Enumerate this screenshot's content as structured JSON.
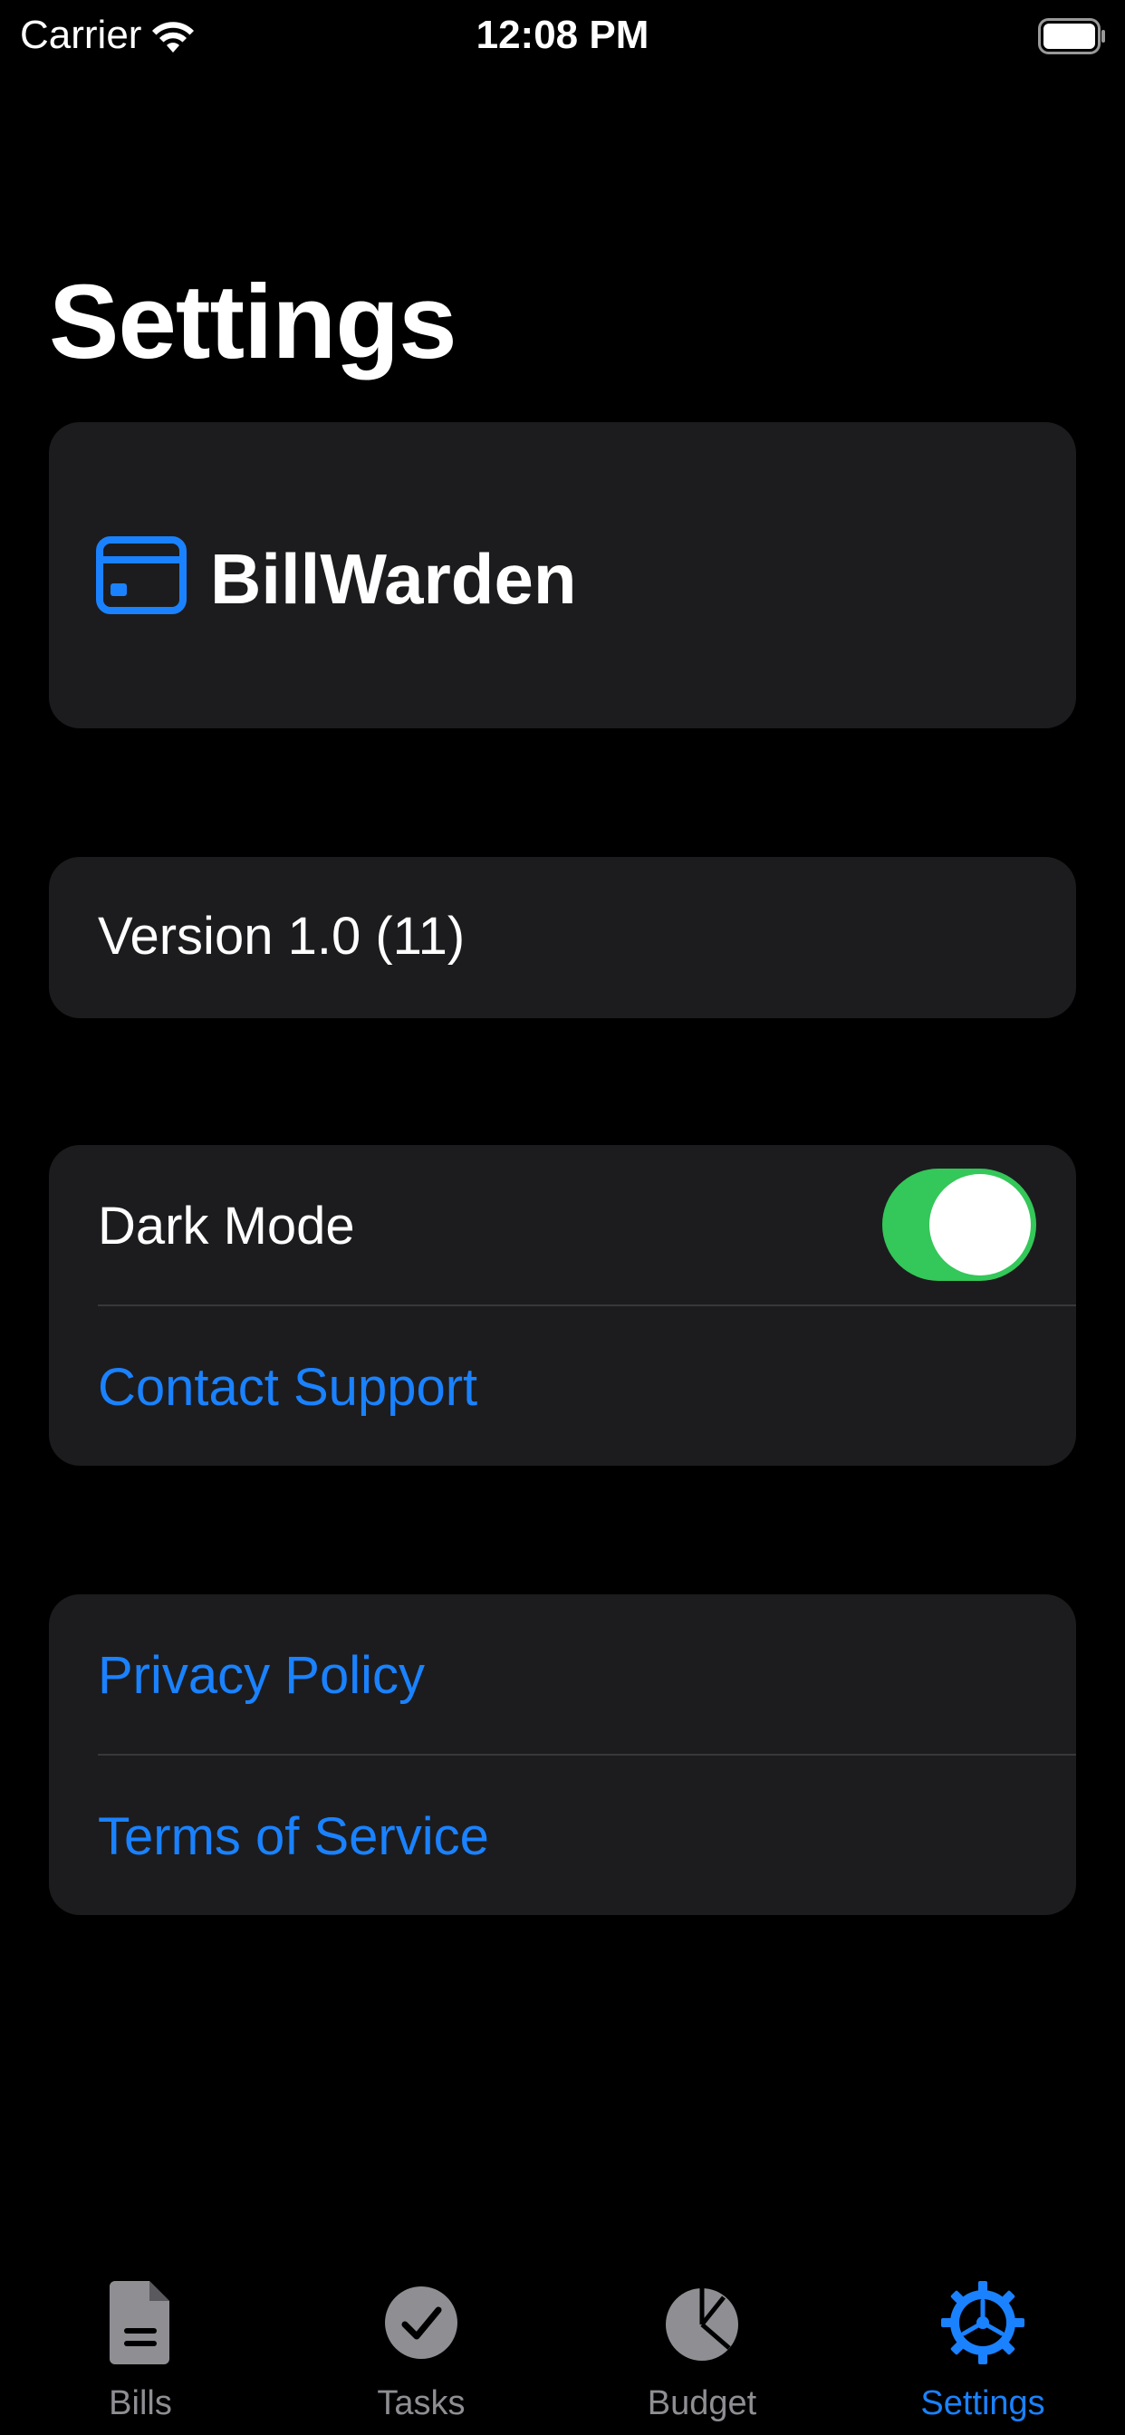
{
  "status_bar": {
    "carrier": "Carrier",
    "time": "12:08 PM"
  },
  "page": {
    "title": "Settings"
  },
  "app_card": {
    "icon": "credit-card-icon",
    "name": "BillWarden"
  },
  "version_card": {
    "text": "Version 1.0 (11)"
  },
  "settings_card": {
    "dark_mode_label": "Dark Mode",
    "dark_mode_on": true,
    "contact_support": "Contact Support"
  },
  "legal_card": {
    "privacy_policy": "Privacy Policy",
    "terms_of_service": "Terms of Service"
  },
  "tab_bar": {
    "tabs": [
      {
        "label": "Bills",
        "icon": "document-icon",
        "active": false
      },
      {
        "label": "Tasks",
        "icon": "checkmark-circle-icon",
        "active": false
      },
      {
        "label": "Budget",
        "icon": "pie-chart-icon",
        "active": false
      },
      {
        "label": "Settings",
        "icon": "gear-icon",
        "active": true
      }
    ]
  },
  "colors": {
    "background": "#000000",
    "card": "#1c1c1e",
    "accent": "#1a82ff",
    "toggle_on": "#34c759",
    "inactive": "#8e8e93"
  }
}
